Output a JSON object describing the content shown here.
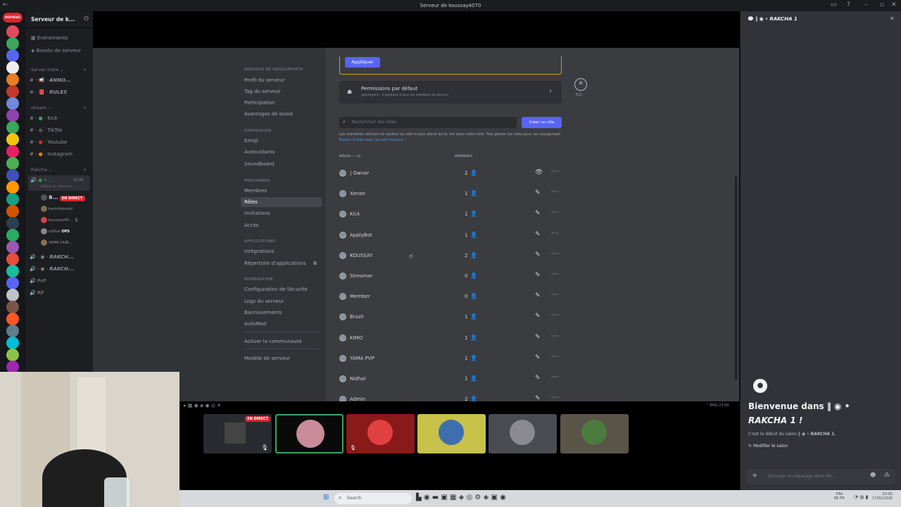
{
  "window": {
    "title": "Serveur de koussay4070"
  },
  "server_list": {
    "badge_new": "NOUVEAU",
    "colors": [
      "#e24a5c",
      "#3ba55c",
      "#5865f2",
      "#eeeeee",
      "#e67e22",
      "#c0392b",
      "#7289da",
      "#8e44ad",
      "#3ba55c",
      "#f1c40f",
      "#e91e63",
      "#4caf50",
      "#3f51b5",
      "#ff9800",
      "#16a085",
      "#d35400",
      "#2c3e50",
      "#27ae60",
      "#9b59b6",
      "#e74c3c",
      "#1abc9c",
      "#5865f2",
      "#bdc3c7",
      "#795548",
      "#ff5722",
      "#607d8b",
      "#00bcd4",
      "#8bc34a",
      "#9c27b0"
    ]
  },
  "channel_sidebar": {
    "server_name": "Serveur de k...",
    "top_items": [
      "Événements",
      "Boosts de serveur"
    ],
    "categories": [
      {
        "name": "Server state",
        "channels": [
          "ANNO...",
          "RULES"
        ]
      },
      {
        "name": "stream",
        "channels": [
          "Kick",
          "TikTok",
          "Youtube",
          "Instagram"
        ]
      },
      {
        "name": "Rakcha",
        "channels": []
      }
    ],
    "voice": {
      "active_channel": "",
      "active_time": "11:26",
      "active_sub": "Définir un statut de...",
      "users": [
        {
          "name": "B...",
          "badge": "EN DIRECT"
        },
        {
          "name": "karimbouzizi",
          "badge": ""
        },
        {
          "name": "koussay40...",
          "badge": ""
        },
        {
          "name": "nidhal",
          "badge": "OPS"
        },
        {
          "name": "YAMA HUB...",
          "badge": ""
        }
      ],
      "more_channels": [
        "RAKCH...",
        "RAKCH...",
        "PvP",
        "RP"
      ]
    }
  },
  "settings_nav": {
    "sections": [
      {
        "header": "SERVEUR DE KOUSSAY4070",
        "items": [
          "Profil du serveur",
          "Tag du serveur",
          "Participation",
          "Avantages de boost"
        ]
      },
      {
        "header": "EXPRESSION",
        "items": [
          "Emoji",
          "Autocollants",
          "Soundboard"
        ]
      },
      {
        "header": "PERSONNES",
        "items": [
          "Membres",
          "Rôles",
          "Invitations",
          "Accès"
        ]
      },
      {
        "header": "APPLICATIONS",
        "items": [
          "Intégrations",
          "Répertoire d'applications"
        ]
      },
      {
        "header": "MODÉRATION",
        "items": [
          "Configuration de Sécurité",
          "Logs du serveur",
          "Bannissements",
          "AutoMod"
        ]
      }
    ],
    "extra": [
      "Activer la communauté",
      "Modèle de serveur"
    ],
    "selected": "Rôles"
  },
  "roles_page": {
    "apply_button": "Appliquer",
    "default_perms_title": "Permissions par défaut",
    "default_perms_sub": "@everyone · s'applique à tous les membres du serveur",
    "search_placeholder": "Rechercher des rôles",
    "create_button": "Créer un rôle",
    "help_text": "Les membres utilisent la couleur du rôle le plus élevé qu'ils ont dans cette liste. Fais glisser les rôles pour les réorganiser.",
    "help_link": "Besoin d'aide avec les permissions ?",
    "col_roles": "RÔLES — 12",
    "col_members": "MEMBRES",
    "close_label": "ESC",
    "roles": [
      {
        "name": "| Owner",
        "count": "2"
      },
      {
        "name": "Xenon",
        "count": "1"
      },
      {
        "name": "Kick",
        "count": "1"
      },
      {
        "name": "ApplyBot",
        "count": "1"
      },
      {
        "name": "KOUSSAY",
        "count": "2"
      },
      {
        "name": "Streamer",
        "count": "0"
      },
      {
        "name": "Member",
        "count": "0"
      },
      {
        "name": "Brazil",
        "count": "1"
      },
      {
        "name": "KIMO",
        "count": "1"
      },
      {
        "name": "YAMA PVP",
        "count": "1"
      },
      {
        "name": "Nidhal",
        "count": "1"
      },
      {
        "name": "Admin",
        "count": "2"
      }
    ]
  },
  "stream_strip": {
    "tray_lang": "ENG",
    "tray_time": "23:00",
    "live_badge": "EN DIRECT"
  },
  "right_panel": {
    "title": "RAKCHA 1",
    "welcome": "Bienvenue dans",
    "welcome_name": "RAKCHA 1 !",
    "start_text": "C'est le début du salon",
    "start_name": "RAKCHA 1.",
    "edit_button": "Modifier le salon",
    "input_placeholder": "Envoyer un message dans RA..."
  },
  "taskbar": {
    "search": "Search",
    "lang": "FRA",
    "lang2": "BE-FR",
    "time": "23:00",
    "date": "17/02/2026"
  }
}
